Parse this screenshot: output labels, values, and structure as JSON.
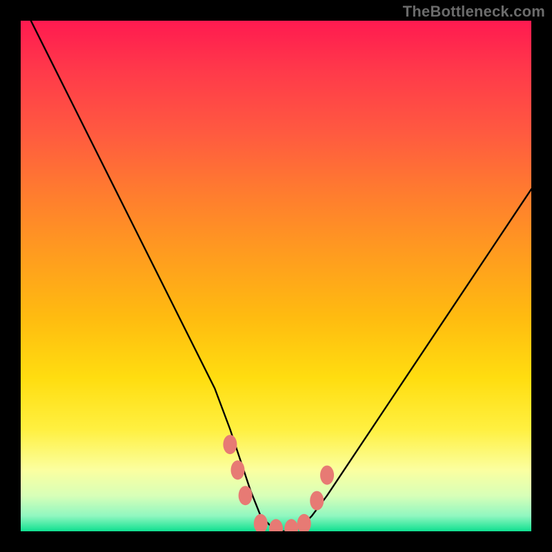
{
  "watermark": "TheBottleneck.com",
  "colors": {
    "frame": "#000000",
    "gradient_top": "#ff1a50",
    "gradient_bottom": "#10e090",
    "marker": "#e77a74",
    "curve": "#000000"
  },
  "chart_data": {
    "type": "line",
    "title": "",
    "xlabel": "",
    "ylabel": "",
    "xlim": [
      0,
      100
    ],
    "ylim": [
      0,
      100
    ],
    "series": [
      {
        "name": "curve",
        "x": [
          2,
          6,
          10,
          14,
          18,
          22,
          26,
          30,
          34,
          38,
          41,
          43,
          45,
          47,
          49,
          51,
          53,
          55,
          57,
          60,
          64,
          68,
          72,
          76,
          80,
          84,
          88,
          92,
          96,
          100
        ],
        "y": [
          100,
          92,
          84,
          76,
          68,
          60,
          52,
          44,
          36,
          28,
          20,
          14,
          8,
          3,
          1,
          0,
          0,
          1,
          3,
          7,
          13,
          19,
          25,
          31,
          37,
          43,
          49,
          55,
          61,
          67
        ]
      }
    ],
    "markers": [
      {
        "x": 41,
        "y": 17
      },
      {
        "x": 42.5,
        "y": 12
      },
      {
        "x": 44,
        "y": 7
      },
      {
        "x": 47,
        "y": 1.5
      },
      {
        "x": 50,
        "y": 0.5
      },
      {
        "x": 53,
        "y": 0.5
      },
      {
        "x": 55.5,
        "y": 1.5
      },
      {
        "x": 58,
        "y": 6
      },
      {
        "x": 60,
        "y": 11
      }
    ]
  }
}
